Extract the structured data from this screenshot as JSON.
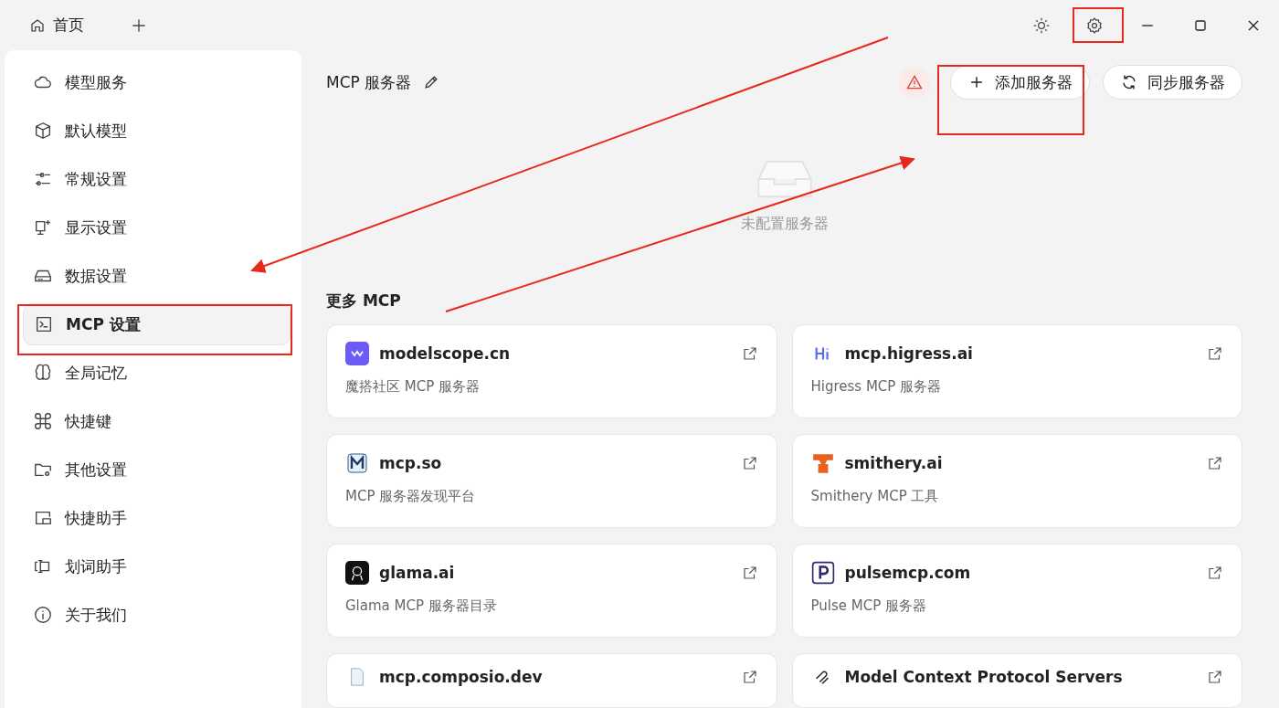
{
  "titlebar": {
    "tabs": [
      {
        "label": "首页",
        "selected": true
      }
    ]
  },
  "sidebar": {
    "items": [
      {
        "label": "模型服务",
        "selected": false
      },
      {
        "label": "默认模型",
        "selected": false
      },
      {
        "label": "常规设置",
        "selected": false
      },
      {
        "label": "显示设置",
        "selected": false
      },
      {
        "label": "数据设置",
        "selected": false
      },
      {
        "label": "MCP 设置",
        "selected": true
      },
      {
        "label": "全局记忆",
        "selected": false
      },
      {
        "label": "快捷键",
        "selected": false
      },
      {
        "label": "其他设置",
        "selected": false
      },
      {
        "label": "快捷助手",
        "selected": false
      },
      {
        "label": "划词助手",
        "selected": false
      },
      {
        "label": "关于我们",
        "selected": false
      }
    ]
  },
  "header": {
    "title": "MCP 服务器",
    "buttons": [
      "添加服务器",
      "同步服务器"
    ]
  },
  "empty_state": {
    "message": "未配置服务器"
  },
  "more": {
    "heading": "更多 MCP",
    "cards": [
      {
        "name": "modelscope.cn",
        "description": "魔搭社区 MCP 服务器"
      },
      {
        "name": "mcp.higress.ai",
        "description": "Higress MCP 服务器"
      },
      {
        "name": "mcp.so",
        "description": "MCP 服务器发现平台"
      },
      {
        "name": "smithery.ai",
        "description": "Smithery MCP 工具"
      },
      {
        "name": "glama.ai",
        "description": "Glama MCP 服务器目录"
      },
      {
        "name": "pulsemcp.com",
        "description": "Pulse MCP 服务器"
      },
      {
        "name": "mcp.composio.dev"
      },
      {
        "name": "Model Context Protocol Servers"
      }
    ]
  }
}
